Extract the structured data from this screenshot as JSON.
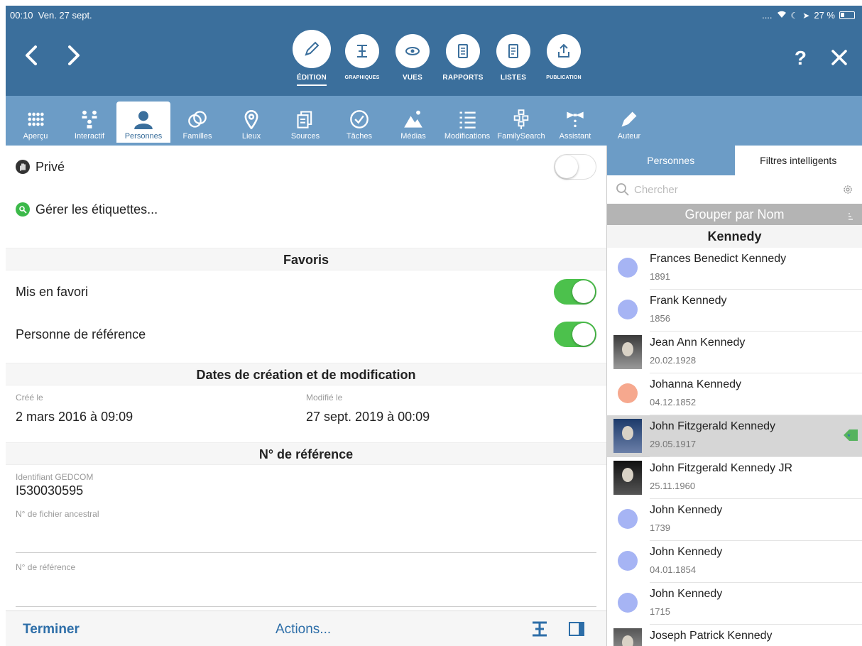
{
  "status": {
    "time": "00:10",
    "date": "Ven. 27 sept.",
    "indicators": "....",
    "battery": "27 %"
  },
  "header": {
    "help_label": "?",
    "modes": [
      {
        "label": "ÉDITION",
        "icon": "pencil-icon",
        "active": true
      },
      {
        "label": "GRAPHIQUES",
        "icon": "chart-tree-icon",
        "active": false
      },
      {
        "label": "VUES",
        "icon": "eye-icon",
        "active": false
      },
      {
        "label": "RAPPORTS",
        "icon": "report-icon",
        "active": false
      },
      {
        "label": "LISTES",
        "icon": "list-document-icon",
        "active": false
      },
      {
        "label": "PUBLICATION",
        "icon": "share-upload-icon",
        "active": false
      }
    ]
  },
  "tabs": [
    {
      "label": "Aperçu",
      "icon": "grid-dots-icon",
      "active": false
    },
    {
      "label": "Interactif",
      "icon": "family-tree-icon",
      "active": false
    },
    {
      "label": "Personnes",
      "icon": "person-icon",
      "active": true
    },
    {
      "label": "Familles",
      "icon": "rings-icon",
      "active": false
    },
    {
      "label": "Lieux",
      "icon": "map-pin-icon",
      "active": false
    },
    {
      "label": "Sources",
      "icon": "documents-icon",
      "active": false
    },
    {
      "label": "Tâches",
      "icon": "checkmark-circle-icon",
      "active": false
    },
    {
      "label": "Médias",
      "icon": "mountain-icon",
      "active": false
    },
    {
      "label": "Modifications",
      "icon": "list-lines-icon",
      "active": false
    },
    {
      "label": "FamilySearch",
      "icon": "familysearch-tree-icon",
      "active": false
    },
    {
      "label": "Assistant",
      "icon": "bowtie-icon",
      "active": false
    },
    {
      "label": "Auteur",
      "icon": "fountain-pen-icon",
      "active": false
    }
  ],
  "main": {
    "private_label": "Privé",
    "private_on": false,
    "tags_label": "Gérer les étiquettes...",
    "favorites_header": "Favoris",
    "favorite_label": "Mis en favori",
    "favorite_on": true,
    "reference_person_label": "Personne de référence",
    "reference_person_on": true,
    "dates_header": "Dates de création et de modification",
    "created_label": "Créé le",
    "created_value": "2 mars 2016 à 09:09",
    "modified_label": "Modifié le",
    "modified_value": "27 sept. 2019 à 00:09",
    "reference_header": "N° de référence",
    "gedcom_label": "Identifiant GEDCOM",
    "gedcom_value": "I530030595",
    "ancestral_file_label": "N° de fichier ancestral",
    "ancestral_file_value": "",
    "reference_number_label": "N° de référence",
    "reference_number_value": ""
  },
  "bottom": {
    "done_label": "Terminer",
    "actions_label": "Actions..."
  },
  "sidebar": {
    "segments": [
      "Personnes",
      "Filtres intelligents"
    ],
    "active_segment": 0,
    "search_placeholder": "Chercher",
    "group_by_label": "Grouper par Nom",
    "group_header": "Kennedy",
    "persons": [
      {
        "name": "Frances Benedict Kennedy",
        "date": "1891",
        "avatar": "circle",
        "color": "#a6b4f4"
      },
      {
        "name": "Frank Kennedy",
        "date": "1856",
        "avatar": "circle",
        "color": "#a6b4f4"
      },
      {
        "name": "Jean Ann Kennedy",
        "date": "20.02.1928",
        "avatar": "photo"
      },
      {
        "name": "Johanna Kennedy",
        "date": "04.12.1852",
        "avatar": "circle",
        "color": "#f6a88e"
      },
      {
        "name": "John Fitzgerald Kennedy",
        "date": "29.05.1917",
        "avatar": "photo",
        "selected": true,
        "tag": true
      },
      {
        "name": "John Fitzgerald Kennedy JR",
        "date": "25.11.1960",
        "avatar": "photo"
      },
      {
        "name": "John Kennedy",
        "date": "1739",
        "avatar": "circle",
        "color": "#a6b4f4"
      },
      {
        "name": "John Kennedy",
        "date": "04.01.1854",
        "avatar": "circle",
        "color": "#a6b4f4"
      },
      {
        "name": "John Kennedy",
        "date": "1715",
        "avatar": "circle",
        "color": "#a6b4f4"
      },
      {
        "name": "Joseph Patrick Kennedy",
        "date": "",
        "avatar": "photo"
      }
    ]
  },
  "colors": {
    "header_blue": "#3b6f9c",
    "tab_blue": "#6c9cc6",
    "toggle_green": "#4cc14c",
    "link_blue": "#2d6ea8"
  }
}
